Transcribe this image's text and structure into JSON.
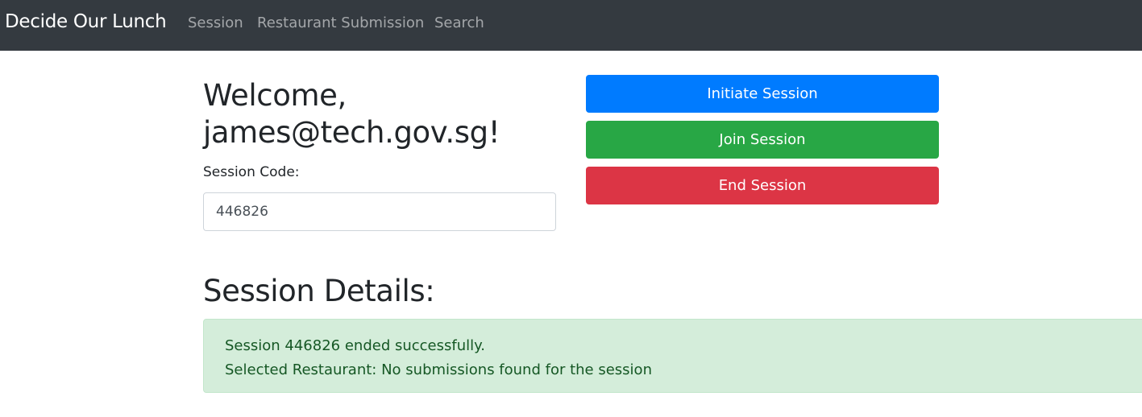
{
  "navbar": {
    "brand": "Decide Our Lunch",
    "links": [
      {
        "label": "Session"
      },
      {
        "label": "Restaurant Submission"
      },
      {
        "label": "Search"
      }
    ]
  },
  "welcome": {
    "line1": "Welcome,",
    "line2": "james@tech.gov.sg!"
  },
  "session_form": {
    "label": "Session Code:",
    "value": "446826"
  },
  "actions": {
    "initiate": "Initiate Session",
    "join": "Join Session",
    "end": "End Session"
  },
  "details": {
    "heading": "Session Details:",
    "message": "Session 446826 ended successfully.",
    "restaurant": "Selected Restaurant: No submissions found for the session"
  },
  "colors": {
    "navbar": "#343a40",
    "primary": "#007bff",
    "success": "#28a745",
    "danger": "#dc3545",
    "alert_bg": "#d4edda",
    "alert_text": "#155724"
  }
}
